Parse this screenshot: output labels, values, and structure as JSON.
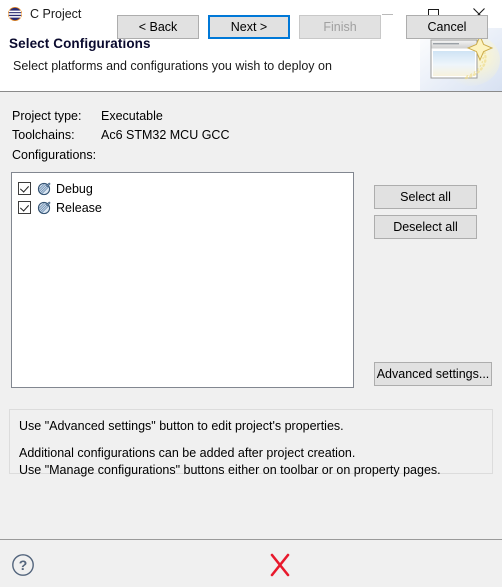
{
  "window": {
    "title": "C Project",
    "icon": "eclipse-sphere-icon",
    "controls": {
      "minimize": "minimize-icon",
      "maximize": "maximize-icon",
      "close": "close-icon"
    }
  },
  "header": {
    "title": "Select Configurations",
    "subtitle": "Select platforms and configurations you wish to deploy on",
    "banner_icon": "wizard-window-sparkle-image"
  },
  "project": {
    "type_label": "Project type:",
    "type_value": "Executable",
    "toolchains_label": "Toolchains:",
    "toolchains_value": "Ac6 STM32 MCU GCC",
    "configurations_label": "Configurations:"
  },
  "configurations": [
    {
      "label": "Debug",
      "checked": true,
      "icon": "build-configuration-icon"
    },
    {
      "label": "Release",
      "checked": true,
      "icon": "build-configuration-icon"
    }
  ],
  "side_buttons": {
    "select_all": "Select all",
    "deselect_all": "Deselect all",
    "advanced_settings": "Advanced settings..."
  },
  "info_panel": {
    "line1": "Use \"Advanced settings\" button to edit project's properties.",
    "line2": "Additional configurations can be added after project creation.",
    "line3": "Use \"Manage configurations\" buttons either on toolbar or on property pages."
  },
  "footer": {
    "help": "help-icon",
    "back": "< Back",
    "next": "Next >",
    "finish": "Finish",
    "cancel": "Cancel",
    "annotation": "red-x-mark"
  },
  "colors": {
    "accent": "#0078d7",
    "annotation": "#e8192c",
    "dialog_bg": "#f0f0f0",
    "title_text": "#0a0a2e",
    "button_face": "#e1e1e1",
    "disabled_text": "#a0a0a0"
  }
}
